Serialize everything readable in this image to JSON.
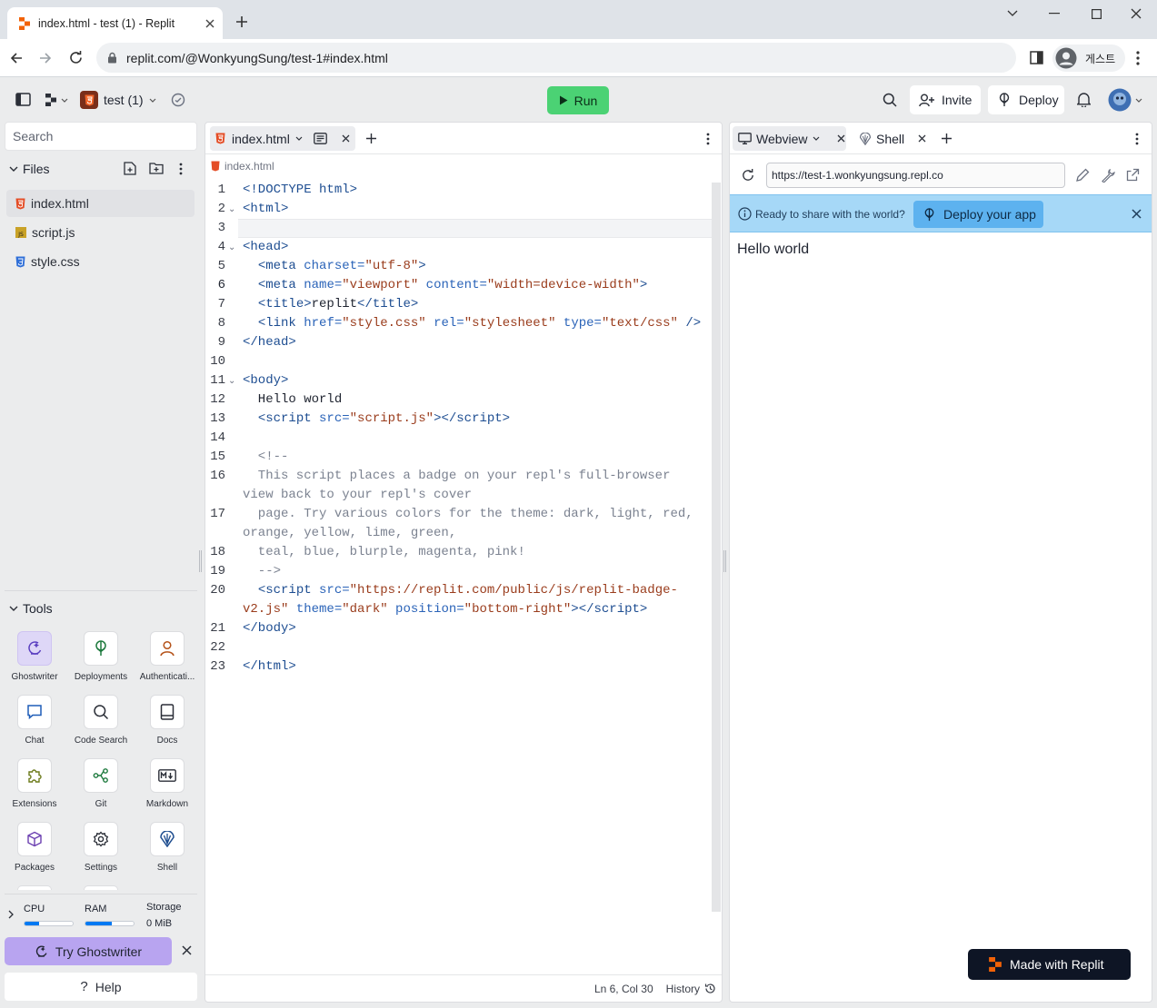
{
  "browser": {
    "tab_title": "index.html - test (1) - Replit",
    "url": "replit.com/@WonkyungSung/test-1#index.html",
    "profile_label": "게스트"
  },
  "topbar": {
    "repl_name": "test (1)",
    "run_label": "Run",
    "invite_label": "Invite",
    "deploy_label": "Deploy"
  },
  "sidebar": {
    "search_placeholder": "Search",
    "files_title": "Files",
    "files": [
      {
        "name": "index.html",
        "type": "html",
        "active": true
      },
      {
        "name": "script.js",
        "type": "js"
      },
      {
        "name": "style.css",
        "type": "css"
      }
    ],
    "tools_title": "Tools",
    "tools": [
      {
        "label": "Ghostwriter",
        "icon": "ghostwriter-icon"
      },
      {
        "label": "Deployments",
        "icon": "deployments-icon"
      },
      {
        "label": "Authenticati...",
        "icon": "user-icon"
      },
      {
        "label": "Chat",
        "icon": "chat-icon"
      },
      {
        "label": "Code Search",
        "icon": "search-icon"
      },
      {
        "label": "Docs",
        "icon": "book-icon"
      },
      {
        "label": "Extensions",
        "icon": "puzzle-icon"
      },
      {
        "label": "Git",
        "icon": "git-icon"
      },
      {
        "label": "Markdown",
        "icon": "markdown-icon"
      },
      {
        "label": "Packages",
        "icon": "package-icon"
      },
      {
        "label": "Settings",
        "icon": "gear-icon"
      },
      {
        "label": "Shell",
        "icon": "shell-icon"
      }
    ],
    "resources": {
      "cpu_label": "CPU",
      "cpu_usage": 0.3,
      "ram_label": "RAM",
      "ram_usage": 0.55,
      "storage_label": "Storage",
      "storage_value": "0 MiB"
    },
    "ghostwriter_cta": "Try Ghostwriter",
    "help_label": "Help"
  },
  "editor": {
    "tab_label": "index.html",
    "breadcrumb": "index.html",
    "cursor_position": "Ln 6, Col 30",
    "history_label": "History",
    "line_numbers": [
      "1",
      "2",
      "3",
      "4",
      "5",
      "6",
      "7",
      "8",
      "9",
      "10",
      "11",
      "12",
      "13",
      "14",
      "15",
      "16",
      "17",
      "18",
      "19",
      "20",
      "21",
      "22",
      "23"
    ]
  },
  "webview": {
    "tab_webview": "Webview",
    "tab_shell": "Shell",
    "url": "https://test-1.wonkyungsung.repl.co",
    "banner_text": "Ready to share with the world?",
    "banner_button": "Deploy your app",
    "content_text": "Hello world",
    "badge_label": "Made with Replit"
  },
  "colors": {
    "run_green": "#4bd274",
    "ghostwriter_purple": "#b8a4f0",
    "banner_blue": "#a6d8f7",
    "replit_orange": "#f26207"
  }
}
